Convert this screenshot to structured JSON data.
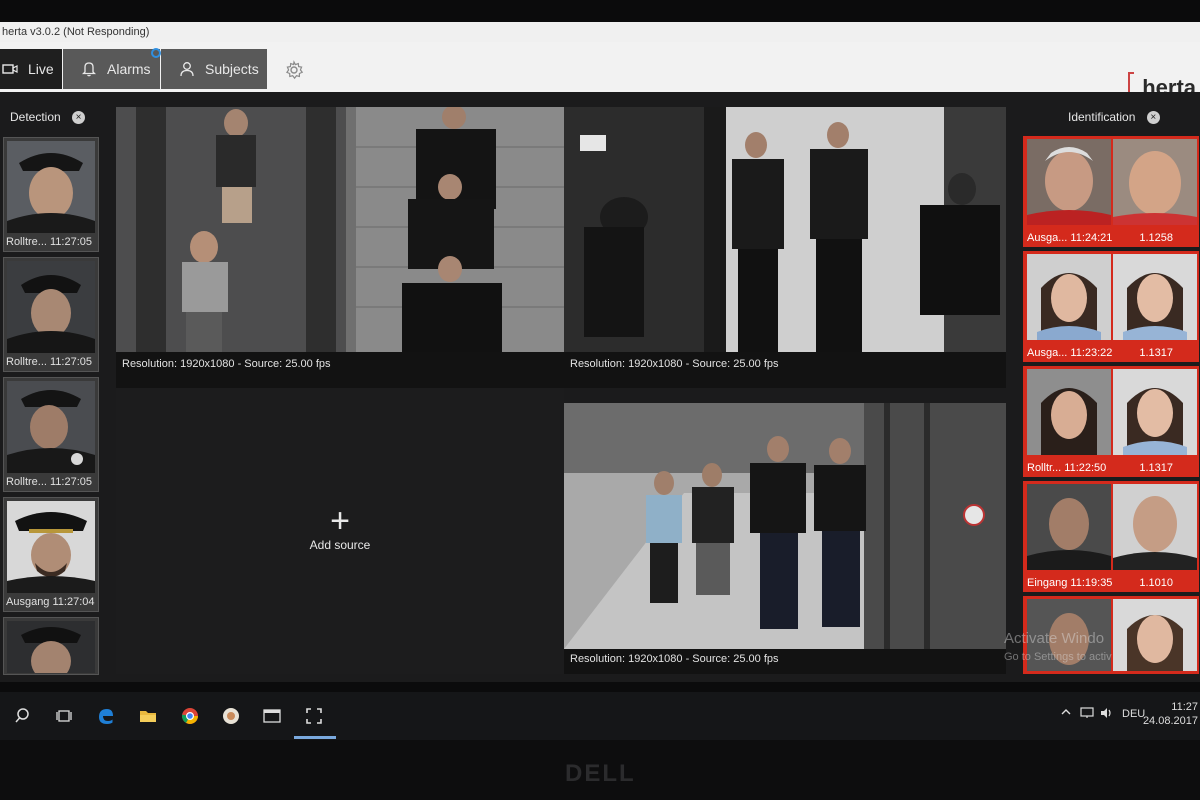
{
  "window": {
    "title": "herta v3.0.2 (Not Responding)"
  },
  "nav": {
    "tabs": [
      {
        "label": "Live",
        "icon": "camera-icon"
      },
      {
        "label": "Alarms",
        "icon": "bell-icon"
      },
      {
        "label": "Subjects",
        "icon": "person-icon"
      }
    ],
    "settings_icon": "gear-icon",
    "logo": "herta"
  },
  "detection": {
    "title": "Detection",
    "items": [
      {
        "label": "Rolltre... 11:27:05"
      },
      {
        "label": "Rolltre... 11:27:05"
      },
      {
        "label": "Rolltre... 11:27:05"
      },
      {
        "label": "Ausgang 11:27:04"
      },
      {
        "label": ""
      }
    ]
  },
  "cameras": [
    {
      "caption": "Resolution: 1920x1080 - Source: 25.00 fps"
    },
    {
      "caption": "Resolution: 1920x1080 - Source: 25.00 fps"
    },
    {
      "caption": "Resolution: 1920x1080 - Source: 25.00 fps"
    }
  ],
  "add_source": {
    "label": "Add source"
  },
  "identification": {
    "title": "Identification",
    "items": [
      {
        "location_time": "Ausga... 11:24:21",
        "score": "1.1258"
      },
      {
        "location_time": "Ausga... 11:23:22",
        "score": "1.1317"
      },
      {
        "location_time": "Rolltr... 11:22:50",
        "score": "1.1317"
      },
      {
        "location_time": "Eingang 11:19:35",
        "score": "1.1010"
      },
      {
        "location_time": "",
        "score": ""
      }
    ]
  },
  "watermark": {
    "line1": "Activate Windo",
    "line2": "Go to Settings to activ"
  },
  "taskbar": {
    "language": "DEU",
    "time": "11:27",
    "date": "24.08.2017"
  },
  "monitor": {
    "brand": "DELL"
  },
  "colors": {
    "accent_red": "#d42a1c",
    "nav_bg": "#f2f2f2",
    "panel_bg": "#1b1b1c",
    "alarm_badge": "#2f8fe0"
  }
}
